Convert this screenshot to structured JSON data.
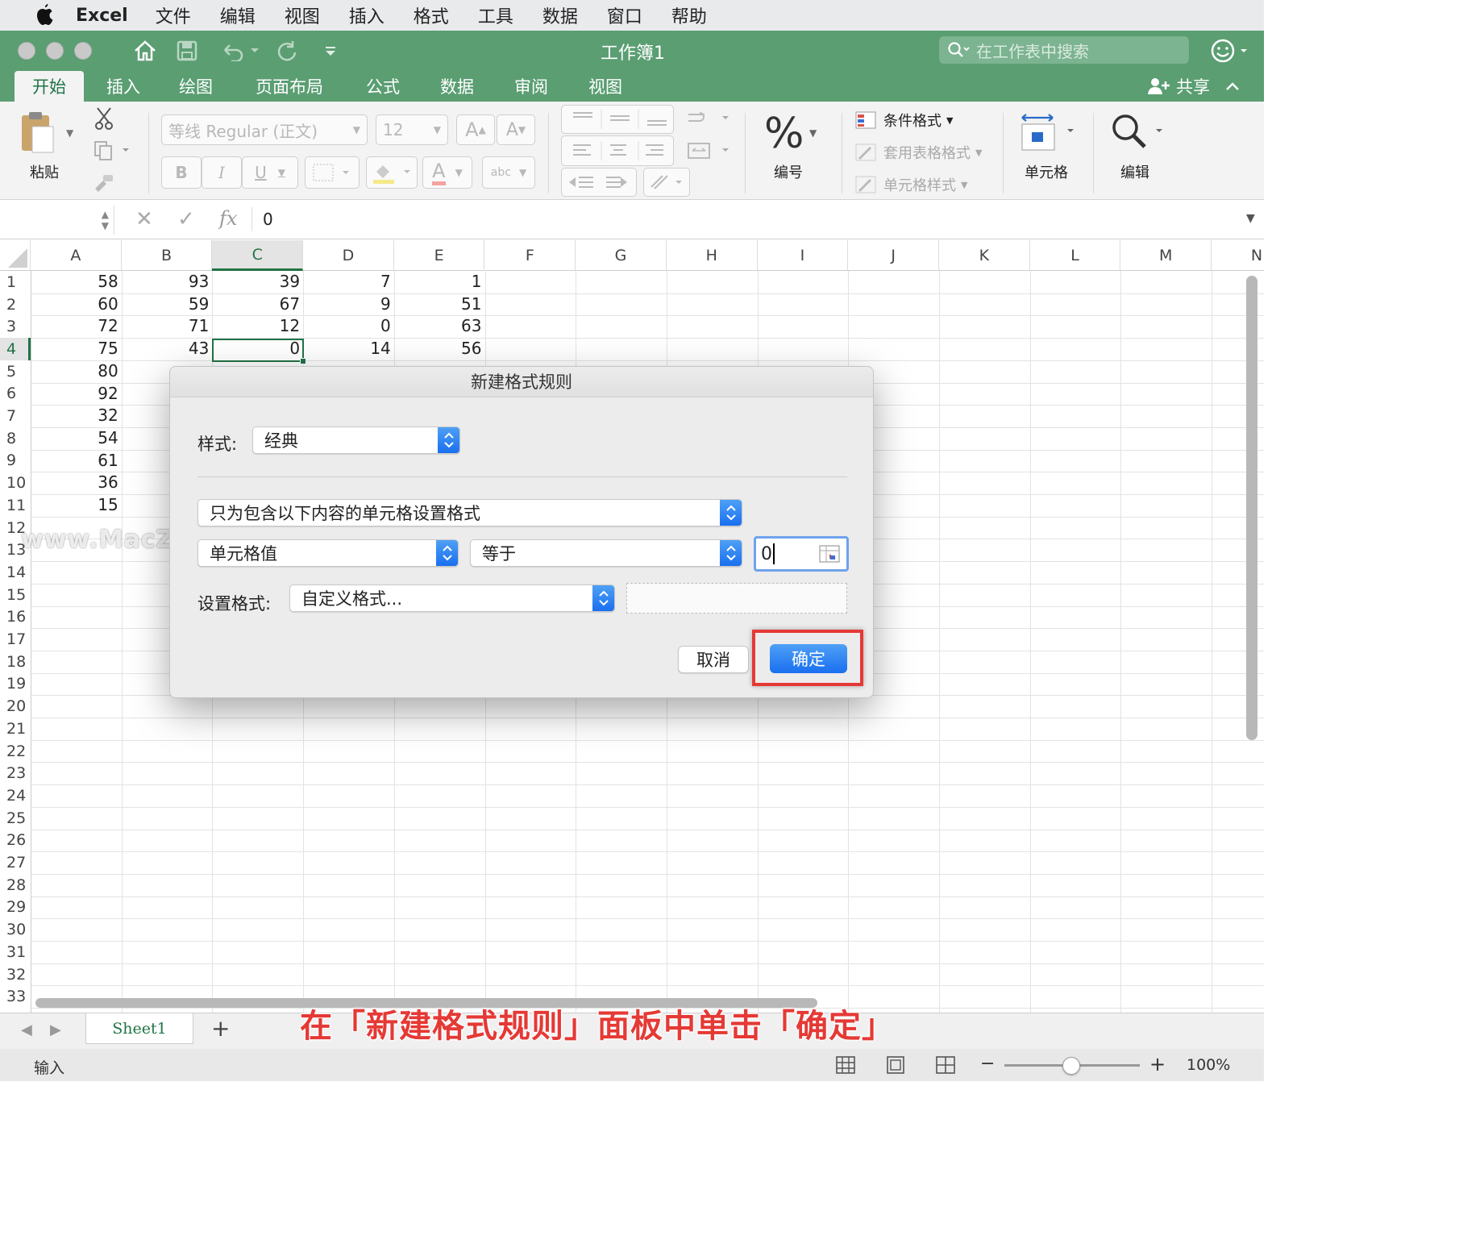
{
  "menubar": {
    "app": "Excel",
    "items": [
      "文件",
      "编辑",
      "视图",
      "插入",
      "格式",
      "工具",
      "数据",
      "窗口",
      "帮助"
    ]
  },
  "window": {
    "title": "工作簿1",
    "search_placeholder": "在工作表中搜索",
    "share": "共享"
  },
  "tabs": [
    "开始",
    "插入",
    "绘图",
    "页面布局",
    "公式",
    "数据",
    "审阅",
    "视图"
  ],
  "ribbon": {
    "paste": "粘贴",
    "font_name": "等线 Regular (正文)",
    "font_size": "12",
    "bold": "B",
    "italic": "I",
    "underline": "U",
    "grow_font": "A",
    "shrink_font": "A",
    "font_color": "A",
    "abc": "abc",
    "number": "编号",
    "number_symbol": "%",
    "conditional_format": "条件格式",
    "format_as_table": "套用表格格式",
    "cell_styles": "单元格样式",
    "cells": "单元格",
    "edit": "编辑"
  },
  "formula_bar": {
    "fx": "fx",
    "value": "0",
    "cancel": "✕",
    "enter": "✓"
  },
  "grid": {
    "columns": [
      "A",
      "B",
      "C",
      "D",
      "E",
      "F",
      "G",
      "H",
      "I",
      "J",
      "K",
      "L",
      "M",
      "N"
    ],
    "rows": [
      "1",
      "2",
      "3",
      "4",
      "5",
      "6",
      "7",
      "8",
      "9",
      "10",
      "11",
      "12",
      "13",
      "14",
      "15",
      "16",
      "17",
      "18",
      "19",
      "20",
      "21",
      "22",
      "23",
      "24",
      "25",
      "26",
      "27",
      "28",
      "29",
      "30",
      "31",
      "32",
      "33"
    ],
    "cells": {
      "A": [
        "58",
        "60",
        "72",
        "75",
        "80",
        "92",
        "32",
        "54",
        "61",
        "36",
        "15"
      ],
      "B": [
        "93",
        "59",
        "71",
        "43"
      ],
      "C": [
        "39",
        "67",
        "12",
        "0"
      ],
      "D": [
        "7",
        "9",
        "0",
        "14"
      ],
      "E": [
        "1",
        "51",
        "63",
        "56"
      ]
    }
  },
  "dialog": {
    "title": "新建格式规则",
    "style_label": "样式:",
    "style_value": "经典",
    "rule_type": "只为包含以下内容的单元格设置格式",
    "cell_value": "单元格值",
    "operator": "等于",
    "value_input": "0",
    "format_label": "设置格式:",
    "format_value": "自定义格式...",
    "cancel": "取消",
    "ok": "确定"
  },
  "sheets": {
    "tab": "Sheet1",
    "add": "+"
  },
  "status": {
    "mode": "输入",
    "zoom": "100%",
    "minus": "−",
    "plus": "+"
  },
  "caption": "在「新建格式规则」面板中单击「确定」",
  "watermark": "www.MacZ.com",
  "colors": {
    "excel_green": "#5a9e72",
    "accent_blue": "#1a6ff0",
    "highlight_red": "#e53935"
  }
}
